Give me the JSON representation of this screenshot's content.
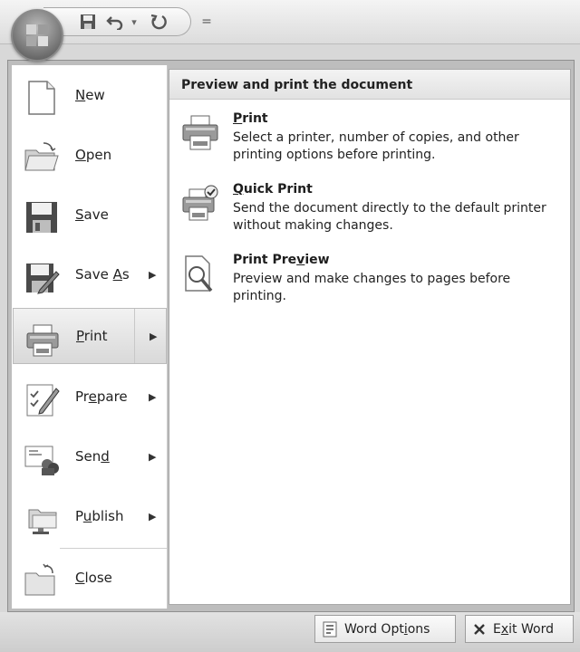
{
  "quick_access": {
    "icons": [
      "office-button-icon",
      "save-icon",
      "undo-icon",
      "redo-icon",
      "customize-dropdown-icon"
    ],
    "undo_dropdown_glyph": "▾",
    "customize_glyph": "="
  },
  "menu": {
    "items": [
      {
        "key": "N",
        "rest": "ew",
        "icon": "new-document-icon"
      },
      {
        "key": "O",
        "rest": "pen",
        "icon": "open-folder-icon"
      },
      {
        "key": "S",
        "rest": "ave",
        "icon": "save-icon"
      },
      {
        "pre": "Save ",
        "key": "A",
        "rest": "s",
        "icon": "save-as-icon",
        "has_submenu": true
      },
      {
        "key": "P",
        "rest": "rint",
        "icon": "print-icon",
        "has_submenu": true,
        "selected": true
      },
      {
        "pre": "Pr",
        "key": "e",
        "rest": "pare",
        "icon": "prepare-icon",
        "has_submenu": true
      },
      {
        "pre": "Sen",
        "key": "d",
        "rest": "",
        "icon": "send-icon",
        "has_submenu": true
      },
      {
        "pre": "P",
        "key": "u",
        "rest": "blish",
        "icon": "publish-icon",
        "has_submenu": true
      },
      {
        "key": "C",
        "rest": "lose",
        "icon": "close-icon"
      }
    ],
    "submenu_arrow": "▶"
  },
  "panel": {
    "title": "Preview and print the document",
    "options": [
      {
        "key": "P",
        "rest": "rint",
        "pre": "",
        "desc": "Select a printer, number of copies, and other printing options before printing.",
        "icon": "printer-icon"
      },
      {
        "key": "Q",
        "rest": "uick Print",
        "pre": "",
        "desc": "Send the document directly to the default printer without making changes.",
        "icon": "quick-print-icon"
      },
      {
        "pre": "Print Pre",
        "key": "v",
        "rest": "iew",
        "desc": "Preview and make changes to pages before printing.",
        "icon": "print-preview-icon"
      }
    ]
  },
  "footer": {
    "word_options": {
      "pre": "Word Opt",
      "key": "i",
      "rest": "ons",
      "icon": "word-options-icon"
    },
    "exit_word": {
      "pre": "E",
      "key": "x",
      "rest": "it Word",
      "icon": "exit-x-icon"
    }
  }
}
